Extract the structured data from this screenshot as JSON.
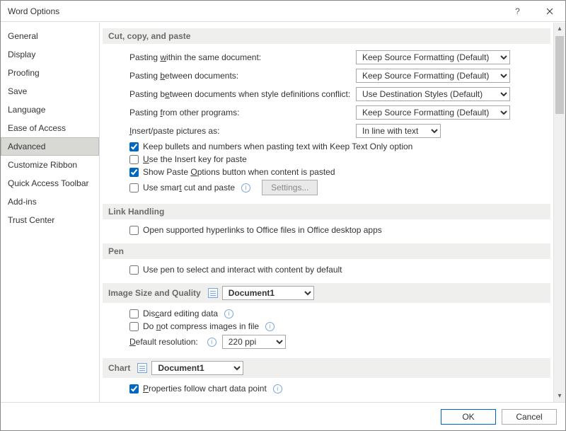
{
  "title": "Word Options",
  "sidebar": {
    "items": [
      {
        "label": "General"
      },
      {
        "label": "Display"
      },
      {
        "label": "Proofing"
      },
      {
        "label": "Save"
      },
      {
        "label": "Language"
      },
      {
        "label": "Ease of Access"
      },
      {
        "label": "Advanced",
        "selected": true
      },
      {
        "label": "Customize Ribbon"
      },
      {
        "label": "Quick Access Toolbar"
      },
      {
        "label": "Add-ins"
      },
      {
        "label": "Trust Center"
      }
    ]
  },
  "sections": {
    "cutcopy": {
      "title": "Cut, copy, and paste",
      "rows": {
        "within": {
          "label_pre": "Pasting ",
          "label_u": "w",
          "label_post": "ithin the same document:",
          "value": "Keep Source Formatting (Default)"
        },
        "between": {
          "label_pre": "Pasting ",
          "label_u": "b",
          "label_post": "etween documents:",
          "value": "Keep Source Formatting (Default)"
        },
        "conflict": {
          "label_pre": "Pasting b",
          "label_u": "e",
          "label_post": "tween documents when style definitions conflict:",
          "value": "Use Destination Styles (Default)"
        },
        "other": {
          "label_pre": "Pasting ",
          "label_u": "f",
          "label_post": "rom other programs:",
          "value": "Keep Source Formatting (Default)"
        },
        "insertpic": {
          "label_pre": "",
          "label_u": "I",
          "label_post": "nsert/paste pictures as:",
          "value": "In line with text"
        }
      },
      "checks": {
        "bullets": {
          "label": "Keep bullets and numbers when pasting text with Keep Text Only option",
          "checked": true
        },
        "insertkey": {
          "label_pre": "",
          "label_u": "U",
          "label_post": "se the Insert key for paste",
          "checked": false
        },
        "showpaste": {
          "label_pre": "Show Paste ",
          "label_u": "O",
          "label_post": "ptions button when content is pasted",
          "checked": true
        },
        "smartcut": {
          "label_pre": "Use smar",
          "label_u": "t",
          "label_post": " cut and paste",
          "checked": false
        }
      },
      "settings_btn": "Settings..."
    },
    "link": {
      "title": "Link Handling",
      "check": {
        "label": "Open supported hyperlinks to Office files in Office desktop apps",
        "checked": false
      }
    },
    "pen": {
      "title": "Pen",
      "check": {
        "label": "Use pen to select and interact with content by default",
        "checked": false
      }
    },
    "image": {
      "title": "Image Size and Quality",
      "doc": "Document1",
      "discard": {
        "label_pre": "Dis",
        "label_u": "c",
        "label_post": "ard editing data",
        "checked": false
      },
      "nocompress": {
        "label_pre": "Do ",
        "label_u": "n",
        "label_post": "ot compress images in file",
        "checked": false
      },
      "res": {
        "label_pre": "",
        "label_u": "D",
        "label_post": "efault resolution:",
        "value": "220 ppi"
      }
    },
    "chart": {
      "title": "Chart",
      "doc": "Document1",
      "props": {
        "label_pre": "",
        "label_u": "P",
        "label_post": "roperties follow chart data point",
        "checked": true
      }
    }
  },
  "footer": {
    "ok": "OK",
    "cancel": "Cancel"
  }
}
